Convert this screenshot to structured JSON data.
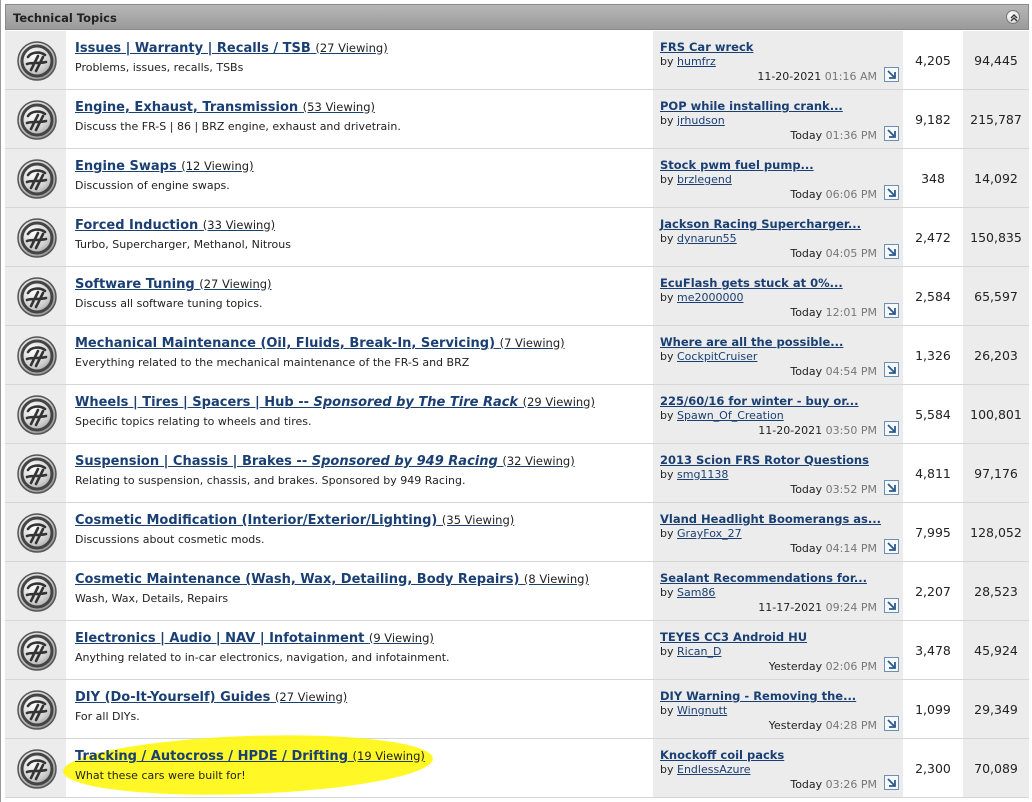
{
  "category": {
    "title": "Technical Topics",
    "collapse_icon": "collapse-up-icon"
  },
  "forums": [
    {
      "title": "Issues | Warranty | Recalls / TSB",
      "viewing": "(27 Viewing)",
      "desc": "Problems, issues, recalls, TSBs",
      "last_title": "FRS Car wreck",
      "by": "by",
      "last_user": "humfrz",
      "date": "11-20-2021",
      "time": "01:16 AM",
      "threads": "4,205",
      "posts": "94,445"
    },
    {
      "title": "Engine, Exhaust, Transmission",
      "viewing": "(53 Viewing)",
      "desc": "Discuss the FR-S | 86 | BRZ engine, exhaust and drivetrain.",
      "last_title": "POP while installing crank...",
      "by": "by",
      "last_user": "jrhudson",
      "date": "Today",
      "time": "01:36 PM",
      "threads": "9,182",
      "posts": "215,787"
    },
    {
      "title": "Engine Swaps",
      "viewing": "(12 Viewing)",
      "desc": "Discussion of engine swaps.",
      "last_title": "Stock pwm fuel pump...",
      "by": "by",
      "last_user": "brzlegend",
      "date": "Today",
      "time": "06:06 PM",
      "threads": "348",
      "posts": "14,092"
    },
    {
      "title": "Forced Induction",
      "viewing": "(33 Viewing)",
      "desc": "Turbo, Supercharger, Methanol, Nitrous",
      "last_title": "Jackson Racing Supercharger...",
      "by": "by",
      "last_user": "dynarun55",
      "date": "Today",
      "time": "04:05 PM",
      "threads": "2,472",
      "posts": "150,835"
    },
    {
      "title": "Software Tuning",
      "viewing": "(27 Viewing)",
      "desc": "Discuss all software tuning topics.",
      "last_title": "EcuFlash gets stuck at 0%...",
      "by": "by",
      "last_user": "me2000000",
      "date": "Today",
      "time": "12:01 PM",
      "threads": "2,584",
      "posts": "65,597"
    },
    {
      "title": "Mechanical Maintenance (Oil, Fluids, Break-In, Servicing)",
      "viewing": "(7 Viewing)",
      "desc": "Everything related to the mechanical maintenance of the FR-S and BRZ",
      "last_title": "Where are all the possible...",
      "by": "by",
      "last_user": "CockpitCruiser",
      "date": "Today",
      "time": "04:54 PM",
      "threads": "1,326",
      "posts": "26,203"
    },
    {
      "title": "Wheels | Tires | Spacers | Hub -- ",
      "sponsor": "Sponsored by The Tire Rack",
      "viewing": "(29 Viewing)",
      "desc": "Specific topics relating to wheels and tires.",
      "last_title": "225/60/16 for winter - buy or...",
      "by": "by",
      "last_user": "Spawn_Of_Creation",
      "date": "11-20-2021",
      "time": "03:50 PM",
      "threads": "5,584",
      "posts": "100,801"
    },
    {
      "title": "Suspension | Chassis | Brakes -- ",
      "sponsor": "Sponsored by 949 Racing",
      "viewing": "(32 Viewing)",
      "desc": "Relating to suspension, chassis, and brakes. Sponsored by 949 Racing.",
      "last_title": "2013 Scion FRS Rotor Questions",
      "by": "by",
      "last_user": "smg1138",
      "date": "Today",
      "time": "03:52 PM",
      "threads": "4,811",
      "posts": "97,176"
    },
    {
      "title": "Cosmetic Modification (Interior/Exterior/Lighting)",
      "viewing": "(35 Viewing)",
      "desc": "Discussions about cosmetic mods.",
      "last_title": "Vland Headlight Boomerangs as...",
      "by": "by",
      "last_user": "GrayFox_27",
      "date": "Today",
      "time": "04:14 PM",
      "threads": "7,995",
      "posts": "128,052"
    },
    {
      "title": "Cosmetic Maintenance (Wash, Wax, Detailing, Body Repairs)",
      "viewing": "(8 Viewing)",
      "desc": "Wash, Wax, Details, Repairs",
      "last_title": "Sealant Recommendations for...",
      "by": "by",
      "last_user": "Sam86",
      "date": "11-17-2021",
      "time": "09:24 PM",
      "threads": "2,207",
      "posts": "28,523"
    },
    {
      "title": "Electronics | Audio | NAV | Infotainment",
      "viewing": "(9 Viewing)",
      "desc": "Anything related to in-car electronics, navigation, and infotainment.",
      "last_title": "TEYES CC3 Android HU",
      "by": "by",
      "last_user": "Rican_D",
      "date": "Yesterday",
      "time": "02:06 PM",
      "threads": "3,478",
      "posts": "45,924"
    },
    {
      "title": "DIY (Do-It-Yourself) Guides",
      "viewing": "(27 Viewing)",
      "desc": "For all DIYs.",
      "last_title": "DIY Warning - Removing the...",
      "by": "by",
      "last_user": "Wingnutt",
      "date": "Yesterday",
      "time": "04:28 PM",
      "threads": "1,099",
      "posts": "29,349"
    },
    {
      "title": "Tracking / Autocross / HPDE / Drifting",
      "viewing": "(19 Viewing)",
      "desc": "What these cars were built for!",
      "last_title": "Knockoff coil packs",
      "by": "by",
      "last_user": "EndlessAzure",
      "date": "Today",
      "time": "03:26 PM",
      "threads": "2,300",
      "posts": "70,089"
    }
  ],
  "icons": {
    "forum": "forum-status-icon",
    "goto": "go-to-last-post-icon"
  }
}
